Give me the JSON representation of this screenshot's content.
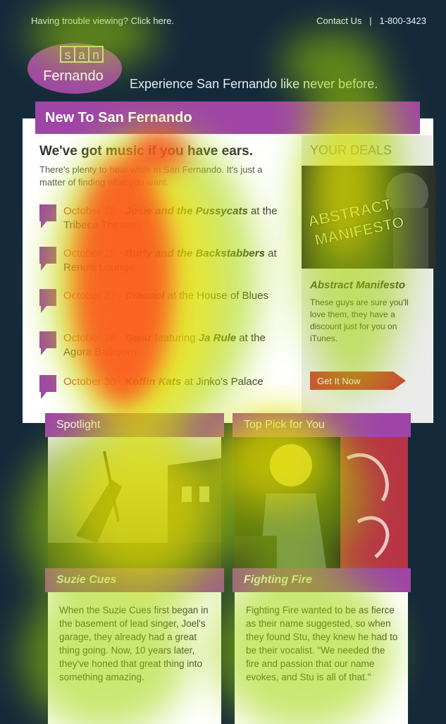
{
  "topbar": {
    "trouble_text": "Having trouble viewing? Click here.",
    "contact_text": "Contact Us   |   1-800-3423"
  },
  "logo": {
    "top": "san",
    "bottom": "Fernando"
  },
  "tagline": "Experience San Fernando like never before.",
  "intro": {
    "bar_title": "New To San Fernando",
    "title": "We've got music if you have ears.",
    "subtitle": "There's plenty to hear while in San Fernando. It's just a matter of finding what you want."
  },
  "events": [
    {
      "date": "October 22 - ",
      "band": "Josie and the Pussycats",
      "rest": " at the Tribeca Theater",
      "guest": "",
      "tail": ""
    },
    {
      "date": "October 25 - ",
      "band": "Burly and the Backstabbers",
      "rest": " at Reno's Lounge",
      "guest": "",
      "tail": ""
    },
    {
      "date": "October 27 - ",
      "band": "Dracool",
      "rest": " at the House of Blues",
      "guest": "",
      "tail": ""
    },
    {
      "date": "October 28 - ",
      "band": "Gwar",
      "rest": " featuring ",
      "guest": "Ja Rule",
      "tail": " at the Agora Ballroom"
    },
    {
      "date": "October 30 - ",
      "band": "Koffin Kats",
      "rest": " at Jinko's Palace",
      "guest": "",
      "tail": ""
    }
  ],
  "deals": {
    "title": "YOUR DEALS",
    "image_label": "ABSTRACT MANIFESTO",
    "name": "Abstract Manifesto",
    "text": "These guys are sure you'll love them, they have a discount just for you on iTunes.",
    "button": "Get It Now"
  },
  "cards": [
    {
      "head": "Spotlight",
      "title": "Suzie Cues",
      "text": "When the Suzie Cues first began in the basement of lead singer, Joel's garage, they already had a great thing going. Now, 10 years later, they've honed that great thing into something amazing."
    },
    {
      "head": "Top Pick for You",
      "title": "Fighting Fire",
      "text": "Fighting Fire wanted to be as fierce as their name suggested, so when they found Stu, they knew he had to be their vocalist. \"We needed the fire and passion that our name evokes, and Stu is all of that.\""
    }
  ],
  "colors": {
    "background": "#14293a",
    "purple": "#9f45a6",
    "accent": "#c94c35"
  },
  "icons": [
    "event-flag-icon",
    "arrow-button-icon"
  ]
}
